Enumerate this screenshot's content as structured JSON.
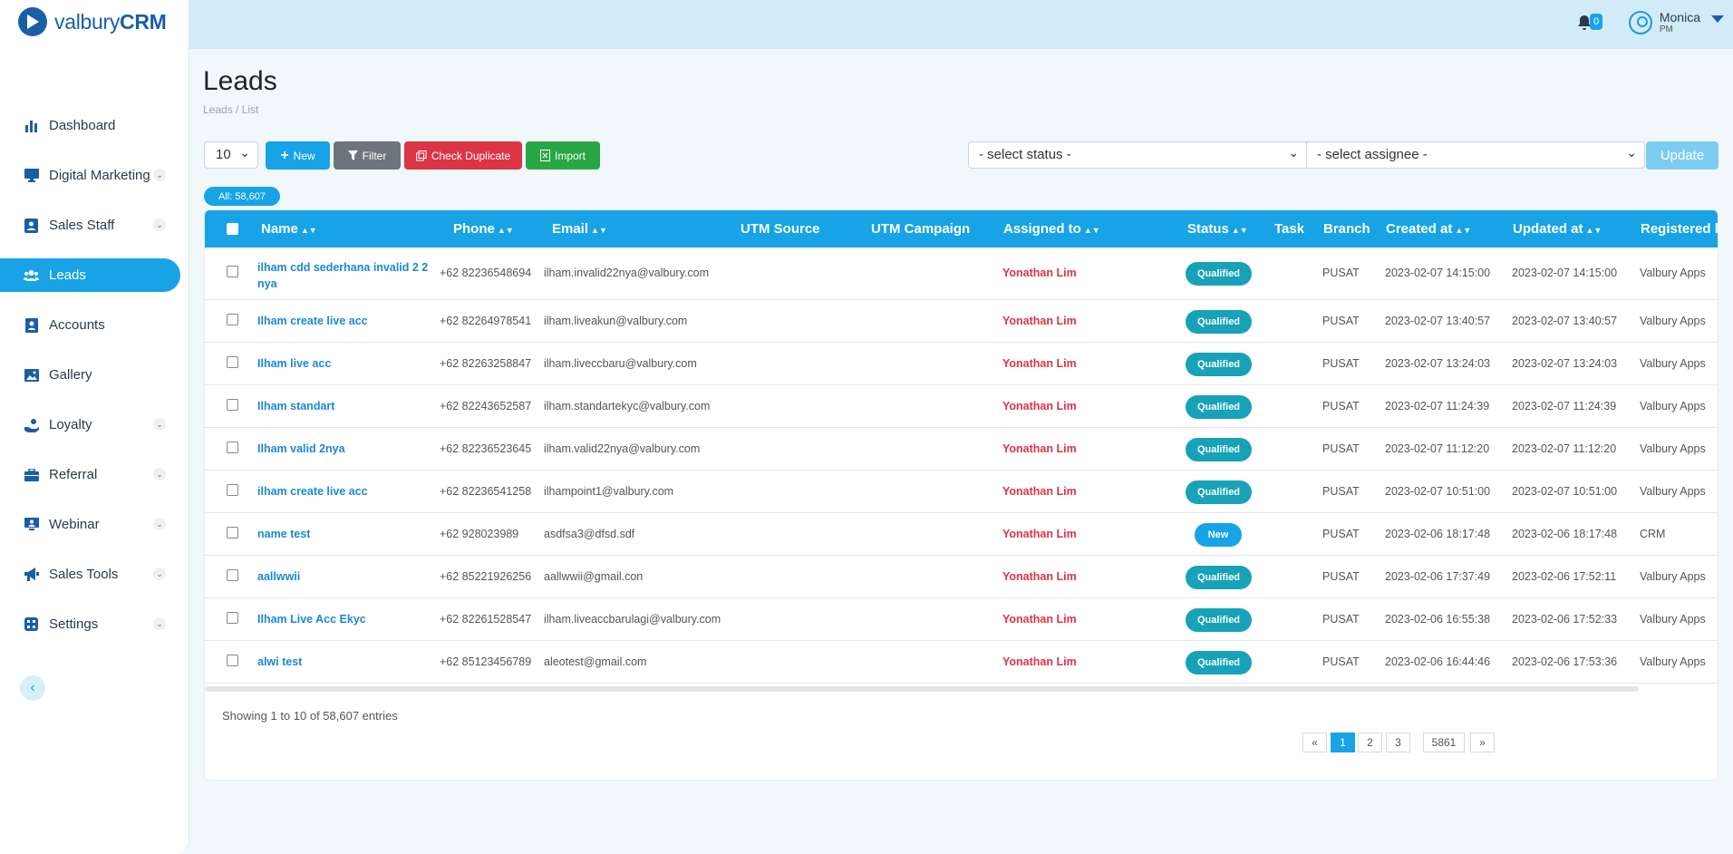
{
  "app": {
    "logo_light": "valbury",
    "logo_bold": "CRM"
  },
  "sidebar": {
    "items": [
      {
        "label": "Dashboard",
        "icon": "bar-chart-icon",
        "chevron": false,
        "active": false
      },
      {
        "label": "Digital Marketing",
        "icon": "monitor-icon",
        "chevron": true,
        "active": false
      },
      {
        "label": "Sales Staff",
        "icon": "id-card-icon",
        "chevron": true,
        "active": false
      },
      {
        "label": "Leads",
        "icon": "users-icon",
        "chevron": false,
        "active": true
      },
      {
        "label": "Accounts",
        "icon": "contact-book-icon",
        "chevron": false,
        "active": false
      },
      {
        "label": "Gallery",
        "icon": "image-icon",
        "chevron": false,
        "active": false
      },
      {
        "label": "Loyalty",
        "icon": "hand-coin-icon",
        "chevron": true,
        "active": false
      },
      {
        "label": "Referral",
        "icon": "briefcase-icon",
        "chevron": true,
        "active": false
      },
      {
        "label": "Webinar",
        "icon": "presentation-icon",
        "chevron": true,
        "active": false
      },
      {
        "label": "Sales Tools",
        "icon": "megaphone-icon",
        "chevron": true,
        "active": false
      },
      {
        "label": "Settings",
        "icon": "settings-grid-icon",
        "chevron": true,
        "active": false
      }
    ]
  },
  "topbar": {
    "notifications": "0",
    "user_name": "Monica",
    "user_role": "PM"
  },
  "page": {
    "title": "Leads",
    "breadcrumb": "Leads / List"
  },
  "toolbar": {
    "page_size": "10",
    "new_label": "New",
    "filter_label": "Filter",
    "check_duplicate_label": "Check Duplicate",
    "import_label": "Import",
    "status_select": "- select status -",
    "assignee_select": "- select assignee -",
    "update_label": "Update",
    "all_count": "All: 58,607"
  },
  "table": {
    "columns": [
      "Name",
      "Phone",
      "Email",
      "UTM Source",
      "UTM Campaign",
      "Assigned to",
      "Status",
      "Task",
      "Branch",
      "Created at",
      "Updated at",
      "Registered by"
    ],
    "rows": [
      {
        "name": "ilham cdd sederhana invalid 2 2",
        "name2": "nya",
        "phone": "+62 82236548694",
        "email": "ilham.invalid22nya@valbury.com",
        "utm_source": "",
        "utm_campaign": "",
        "assigned": "Yonathan Lim",
        "status": "Qualified",
        "task": "",
        "branch": "PUSAT",
        "created": "2023-02-07 14:15:00",
        "updated": "2023-02-07 14:15:00",
        "registered": "Valbury Apps"
      },
      {
        "name": "Ilham create live acc",
        "name2": "",
        "phone": "+62 82264978541",
        "email": "ilham.liveakun@valbury.com",
        "utm_source": "",
        "utm_campaign": "",
        "assigned": "Yonathan Lim",
        "status": "Qualified",
        "task": "",
        "branch": "PUSAT",
        "created": "2023-02-07 13:40:57",
        "updated": "2023-02-07 13:40:57",
        "registered": "Valbury Apps"
      },
      {
        "name": "Ilham live acc",
        "name2": "",
        "phone": "+62 82263258847",
        "email": "ilham.liveccbaru@valbury.com",
        "utm_source": "",
        "utm_campaign": "",
        "assigned": "Yonathan Lim",
        "status": "Qualified",
        "task": "",
        "branch": "PUSAT",
        "created": "2023-02-07 13:24:03",
        "updated": "2023-02-07 13:24:03",
        "registered": "Valbury Apps"
      },
      {
        "name": "Ilham standart",
        "name2": "",
        "phone": "+62 82243652587",
        "email": "ilham.standartekyc@valbury.com",
        "utm_source": "",
        "utm_campaign": "",
        "assigned": "Yonathan Lim",
        "status": "Qualified",
        "task": "",
        "branch": "PUSAT",
        "created": "2023-02-07 11:24:39",
        "updated": "2023-02-07 11:24:39",
        "registered": "Valbury Apps"
      },
      {
        "name": "Ilham valid 2nya",
        "name2": "",
        "phone": "+62 82236523645",
        "email": "ilham.valid22nya@valbury.com",
        "utm_source": "",
        "utm_campaign": "",
        "assigned": "Yonathan Lim",
        "status": "Qualified",
        "task": "",
        "branch": "PUSAT",
        "created": "2023-02-07 11:12:20",
        "updated": "2023-02-07 11:12:20",
        "registered": "Valbury Apps"
      },
      {
        "name": "ilham create live acc",
        "name2": "",
        "phone": "+62 82236541258",
        "email": "ilhampoint1@valbury.com",
        "utm_source": "",
        "utm_campaign": "",
        "assigned": "Yonathan Lim",
        "status": "Qualified",
        "task": "",
        "branch": "PUSAT",
        "created": "2023-02-07 10:51:00",
        "updated": "2023-02-07 10:51:00",
        "registered": "Valbury Apps"
      },
      {
        "name": "name test",
        "name2": "",
        "phone": "+62 928023989",
        "email": "asdfsa3@dfsd.sdf",
        "utm_source": "",
        "utm_campaign": "",
        "assigned": "Yonathan Lim",
        "status": "New",
        "task": "",
        "branch": "PUSAT",
        "created": "2023-02-06 18:17:48",
        "updated": "2023-02-06 18:17:48",
        "registered": "CRM"
      },
      {
        "name": "aallwwii",
        "name2": "",
        "phone": "+62 85221926256",
        "email": "aallwwii@gmail.con",
        "utm_source": "",
        "utm_campaign": "",
        "assigned": "Yonathan Lim",
        "status": "Qualified",
        "task": "",
        "branch": "PUSAT",
        "created": "2023-02-06 17:37:49",
        "updated": "2023-02-06 17:52:11",
        "registered": "Valbury Apps"
      },
      {
        "name": "Ilham Live Acc Ekyc",
        "name2": "",
        "phone": "+62 82261528547",
        "email": "ilham.liveaccbarulagi@valbury.com",
        "utm_source": "",
        "utm_campaign": "",
        "assigned": "Yonathan Lim",
        "status": "Qualified",
        "task": "",
        "branch": "PUSAT",
        "created": "2023-02-06 16:55:38",
        "updated": "2023-02-06 17:52:33",
        "registered": "Valbury Apps"
      },
      {
        "name": "alwi test",
        "name2": "",
        "phone": "+62 85123456789",
        "email": "aleotest@gmail.com",
        "utm_source": "",
        "utm_campaign": "",
        "assigned": "Yonathan Lim",
        "status": "Qualified",
        "task": "",
        "branch": "PUSAT",
        "created": "2023-02-06 16:44:46",
        "updated": "2023-02-06 17:53:36",
        "registered": "Valbury Apps"
      }
    ]
  },
  "footer": {
    "showing": "Showing 1 to 10 of 58,607 entries",
    "pager": [
      "«",
      "1",
      "2",
      "3",
      "5861",
      "»"
    ]
  },
  "colors": {
    "primary": "#17a3e6",
    "brand": "#1b5ea8",
    "danger": "#dc3545",
    "success": "#28a745",
    "qualified": "#17a2b8"
  }
}
